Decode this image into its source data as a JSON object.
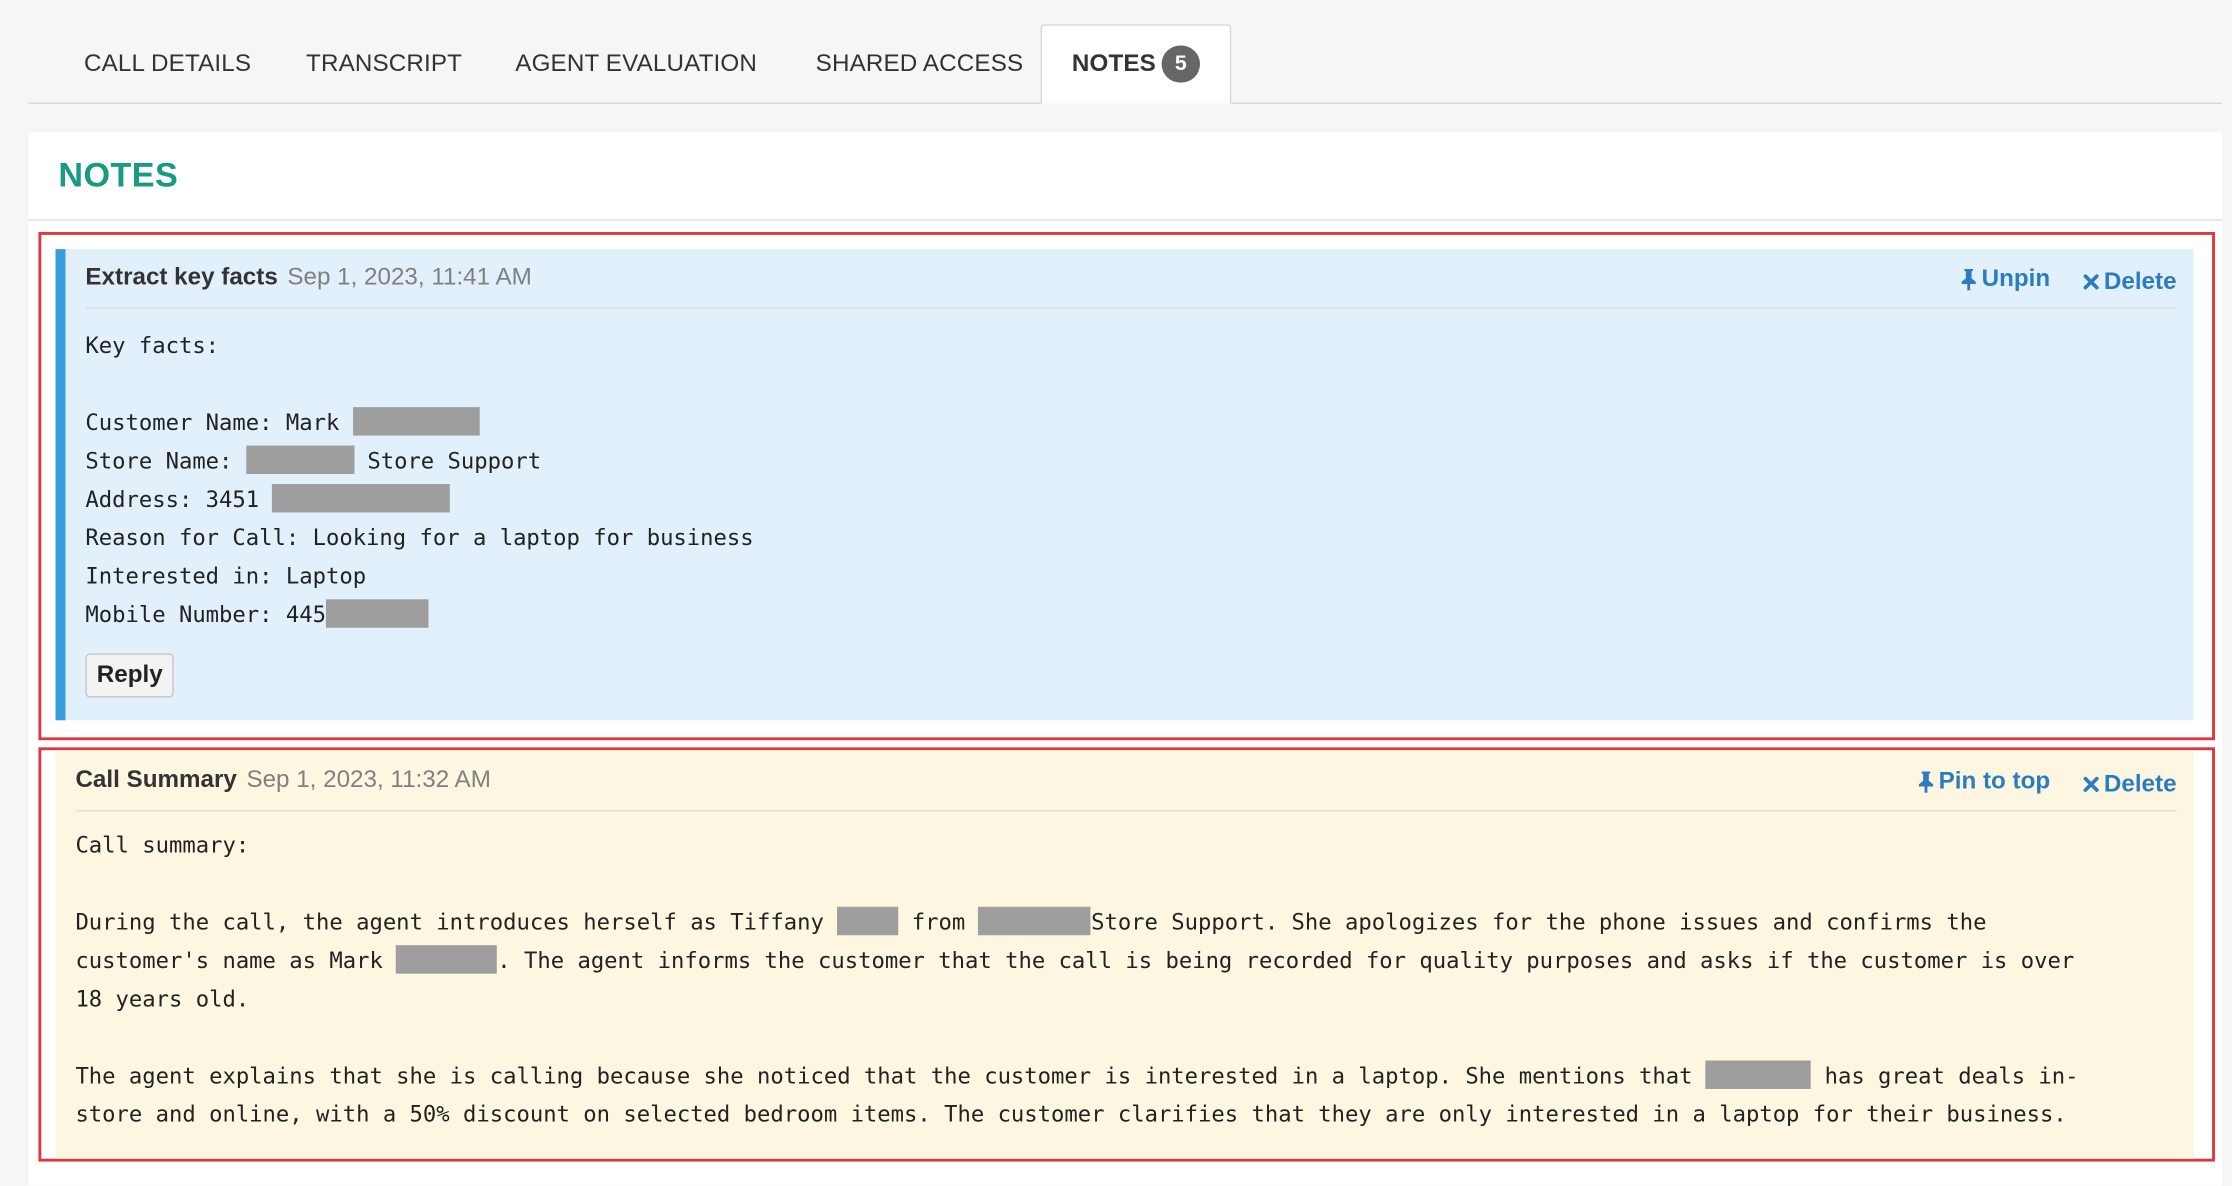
{
  "tabs": [
    {
      "label": "CALL DETAILS"
    },
    {
      "label": "TRANSCRIPT"
    },
    {
      "label": "AGENT EVALUATION"
    },
    {
      "label": "SHARED ACCESS"
    },
    {
      "label": "NOTES",
      "badge": "5",
      "active": true
    }
  ],
  "panel": {
    "title": "NOTES"
  },
  "colors": {
    "accent_title": "#1a9a82",
    "pinned_bg": "#e1f0fa",
    "pinned_bar": "#3a9ddb",
    "note_bg": "#fdf7e2",
    "link": "#2b7dc0",
    "highlight_border": "#e0353c"
  },
  "notes": [
    {
      "title": "Extract key facts",
      "timestamp": "Sep 1, 2023, 11:41 AM",
      "pinned": true,
      "pin_action": "Unpin",
      "delete_action": "Delete",
      "reply_label": "Reply",
      "lines": {
        "l1": "Key facts:",
        "l2a": "Customer Name: Mark ",
        "l3a": "Store Name: ",
        "l3b": " Store Support",
        "l4a": "Address: 3451 ",
        "l5": "Reason for Call: Looking for a laptop for business",
        "l6": "Interested in: Laptop",
        "l7a": "Mobile Number: 445"
      }
    },
    {
      "title": "Call Summary",
      "timestamp": "Sep 1, 2023, 11:32 AM",
      "pinned": false,
      "pin_action": "Pin to top",
      "delete_action": "Delete",
      "lines": {
        "l1": "Call summary:",
        "l2a": "During the call, the agent introduces herself as Tiffany ",
        "l2b": " from ",
        "l2c": "Store Support. She apologizes for the phone issues and confirms the",
        "l3a": "customer's name as Mark ",
        "l3b": ". The agent informs the customer that the call is being recorded for quality purposes and asks if the customer is over",
        "l4": "18 years old.",
        "l5a": "The agent explains that she is calling because she noticed that the customer is interested in a laptop. She mentions that ",
        "l5b": " has great deals in-",
        "l6": "store and online, with a 50% discount on selected bedroom items. The customer clarifies that they are only interested in a laptop for their business."
      }
    }
  ],
  "icons": {
    "pin": "pushpin-icon",
    "delete": "close-icon"
  }
}
